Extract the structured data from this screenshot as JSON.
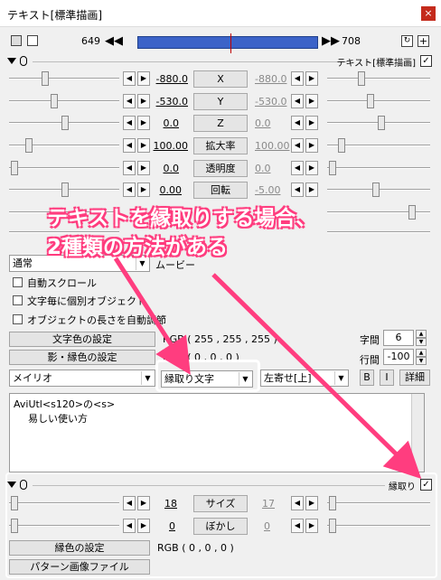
{
  "window": {
    "title": "テキスト[標準描画]",
    "close": "×"
  },
  "frame": {
    "start": "649",
    "end": "708"
  },
  "sections": {
    "text": {
      "name": "テキスト[標準描画]",
      "checked": "✓"
    },
    "border": {
      "name": "縁取り",
      "checked": "✓"
    }
  },
  "params": [
    {
      "left": "-880.0",
      "label": "X",
      "right": "-880.0"
    },
    {
      "left": "-530.0",
      "label": "Y",
      "right": "-530.0"
    },
    {
      "left": "0.0",
      "label": "Z",
      "right": "0.0"
    },
    {
      "left": "100.00",
      "label": "拡大率",
      "right": "100.00"
    },
    {
      "left": "0.0",
      "label": "透明度",
      "right": "0.0"
    },
    {
      "left": "0.00",
      "label": "回転",
      "right": "-5.00"
    },
    {
      "left": "",
      "label": "",
      "right": ""
    },
    {
      "left": "",
      "label": "",
      "right": ""
    }
  ],
  "options": {
    "blend": "通常",
    "blend_extra": "ムービー",
    "auto_scroll": "自動スクロール",
    "per_char": "文字毎に個別オブジェクト",
    "auto_length": "オブジェクトの長さを自動調節"
  },
  "color": {
    "text_btn": "文字色の設定",
    "text_val": "RGB ( 255 , 255 , 255 )",
    "shadow_btn": "影・縁色の設定",
    "shadow_val": "RGB ( 0 , 0 , 0 )"
  },
  "spacing": {
    "char_label": "字間",
    "char_val": "6",
    "line_label": "行間",
    "line_val": "-100"
  },
  "font": {
    "name": "メイリオ",
    "style": "縁取り文字",
    "align": "左寄せ[上]",
    "bold": "B",
    "italic": "I",
    "detail": "詳細"
  },
  "text_content": {
    "line1": "AviUtl<s120>の<s>",
    "line2": "易しい使い方"
  },
  "border_params": [
    {
      "left": "18",
      "label": "サイズ",
      "right": "17"
    },
    {
      "left": "0",
      "label": "ぼかし",
      "right": "0"
    }
  ],
  "border_color": {
    "btn": "縁色の設定",
    "val": "RGB ( 0 , 0 , 0 )",
    "pattern": "パターン画像ファイル"
  },
  "annotation": {
    "line1": "テキストを縁取りする場合、",
    "line2": "2種類の方法がある"
  },
  "colors": {
    "accent_pink": "#ff3d7f",
    "frame_bar": "#3c63c8"
  }
}
